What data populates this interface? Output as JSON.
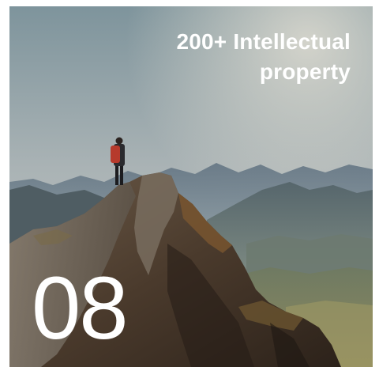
{
  "card": {
    "caption": "200+ Intellectual property",
    "number": "08"
  }
}
